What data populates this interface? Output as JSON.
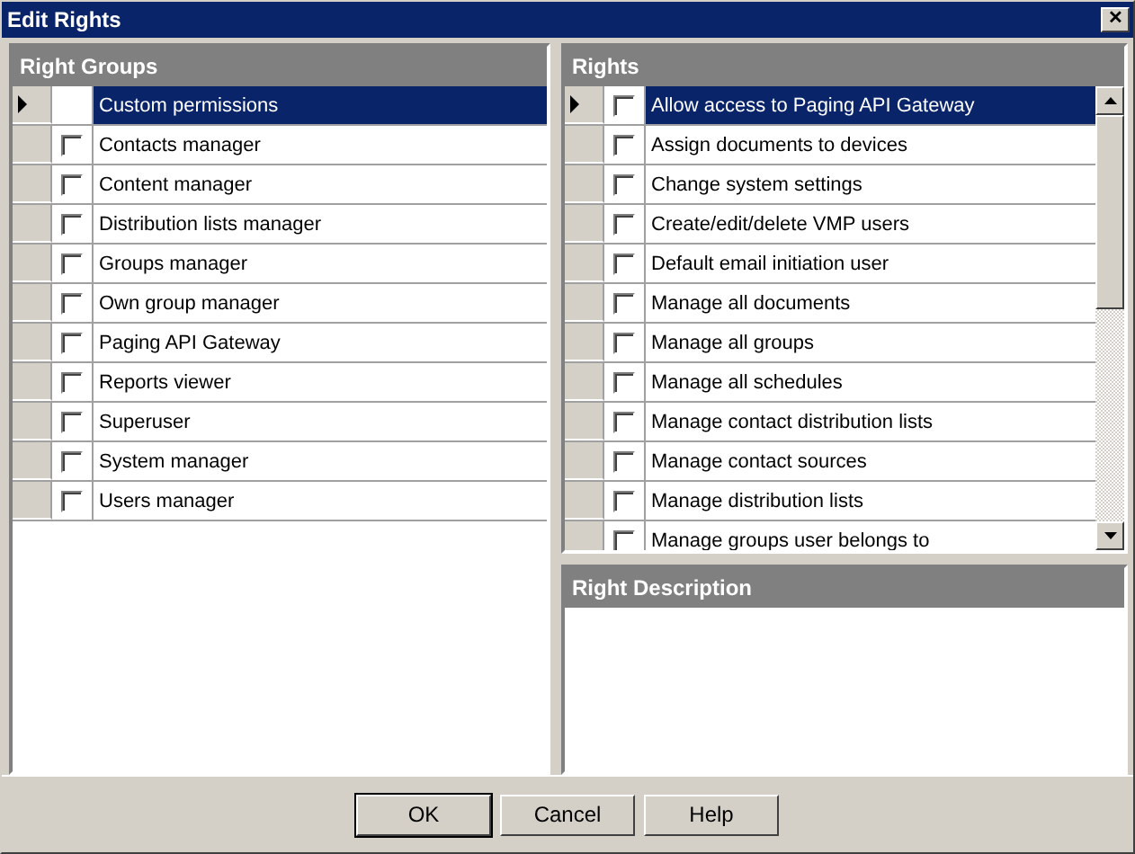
{
  "window": {
    "title": "Edit Rights",
    "close": "✕"
  },
  "right_groups": {
    "title": "Right Groups",
    "items": [
      {
        "label": "Custom permissions",
        "kind": "plain",
        "selected": true
      },
      {
        "label": "Contacts manager",
        "kind": "checkbox",
        "checked": false,
        "selected": false
      },
      {
        "label": "Content manager",
        "kind": "checkbox",
        "checked": false,
        "selected": false
      },
      {
        "label": "Distribution lists manager",
        "kind": "checkbox",
        "checked": false,
        "selected": false
      },
      {
        "label": "Groups manager",
        "kind": "checkbox",
        "checked": false,
        "selected": false
      },
      {
        "label": "Own group manager",
        "kind": "checkbox",
        "checked": false,
        "selected": false
      },
      {
        "label": "Paging API Gateway",
        "kind": "checkbox",
        "checked": false,
        "selected": false
      },
      {
        "label": "Reports viewer",
        "kind": "checkbox",
        "checked": false,
        "selected": false
      },
      {
        "label": "Superuser",
        "kind": "checkbox",
        "checked": false,
        "selected": false
      },
      {
        "label": "System manager",
        "kind": "checkbox",
        "checked": false,
        "selected": false
      },
      {
        "label": "Users manager",
        "kind": "checkbox",
        "checked": false,
        "selected": false
      }
    ]
  },
  "rights": {
    "title": "Rights",
    "items": [
      {
        "label": "Allow access to Paging API Gateway",
        "kind": "checkbox",
        "checked": false,
        "selected": true
      },
      {
        "label": "Assign documents to devices",
        "kind": "checkbox",
        "checked": false,
        "selected": false
      },
      {
        "label": "Change system settings",
        "kind": "checkbox",
        "checked": false,
        "selected": false
      },
      {
        "label": "Create/edit/delete VMP users",
        "kind": "checkbox",
        "checked": false,
        "selected": false
      },
      {
        "label": "Default email initiation user",
        "kind": "checkbox",
        "checked": false,
        "selected": false
      },
      {
        "label": "Manage all documents",
        "kind": "checkbox",
        "checked": false,
        "selected": false
      },
      {
        "label": "Manage all groups",
        "kind": "checkbox",
        "checked": false,
        "selected": false
      },
      {
        "label": "Manage all schedules",
        "kind": "checkbox",
        "checked": false,
        "selected": false
      },
      {
        "label": "Manage contact distribution lists",
        "kind": "checkbox",
        "checked": false,
        "selected": false
      },
      {
        "label": "Manage contact sources",
        "kind": "checkbox",
        "checked": false,
        "selected": false
      },
      {
        "label": "Manage distribution lists",
        "kind": "checkbox",
        "checked": false,
        "selected": false
      },
      {
        "label": "Manage groups user belongs to",
        "kind": "checkbox",
        "checked": false,
        "selected": false
      }
    ]
  },
  "right_description": {
    "title": "Right Description"
  },
  "buttons": [
    "OK",
    "Cancel",
    "Help"
  ]
}
